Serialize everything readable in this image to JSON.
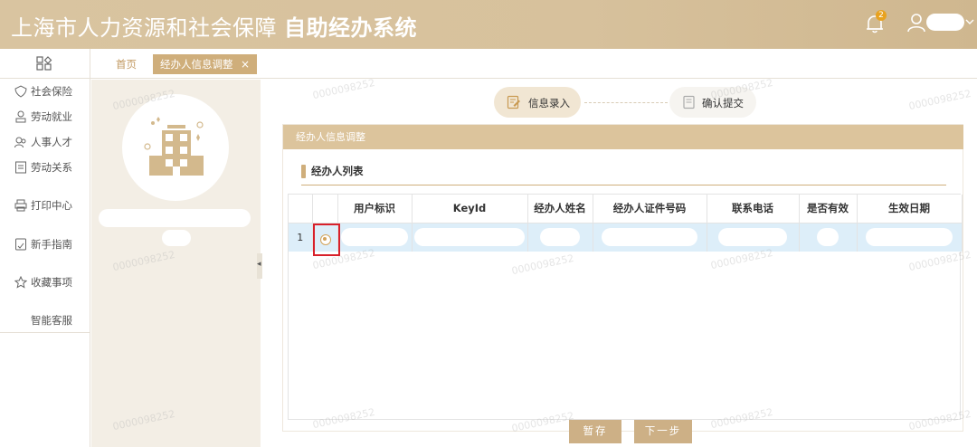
{
  "header": {
    "title_regular": "上海市人力资源和社会保障",
    "title_bold": "自助经办系统",
    "notification_count": "2"
  },
  "sidebar": {
    "items": [
      {
        "label": "社会保险",
        "icon": "shield-heart-icon"
      },
      {
        "label": "劳动就业",
        "icon": "person-badge-icon"
      },
      {
        "label": "人事人才",
        "icon": "people-icon"
      },
      {
        "label": "劳动关系",
        "icon": "document-list-icon"
      },
      {
        "label": "打印中心",
        "icon": "printer-icon"
      },
      {
        "label": "新手指南",
        "icon": "guide-icon"
      },
      {
        "label": "收藏事项",
        "icon": "star-icon"
      },
      {
        "label": "智能客服",
        "icon": ""
      }
    ]
  },
  "tabs": {
    "home": "首页",
    "active": "经办人信息调整",
    "close": "×"
  },
  "steps": {
    "step1": "信息录入",
    "step2": "确认提交"
  },
  "panel": {
    "header": "经办人信息调整",
    "list_title": "经办人列表"
  },
  "table": {
    "columns": [
      "",
      "",
      "用户标识",
      "KeyId",
      "经办人姓名",
      "经办人证件号码",
      "联系电话",
      "是否有效",
      "生效日期"
    ],
    "rows": [
      {
        "index": "1"
      }
    ]
  },
  "buttons": {
    "save": "暂存",
    "next": "下一步"
  },
  "watermark": "0000098252",
  "colors": {
    "header_bg": "#d9c4a0",
    "accent": "#cfae7b",
    "selected_row": "#ddeef9",
    "highlight_box": "#d8202a"
  }
}
